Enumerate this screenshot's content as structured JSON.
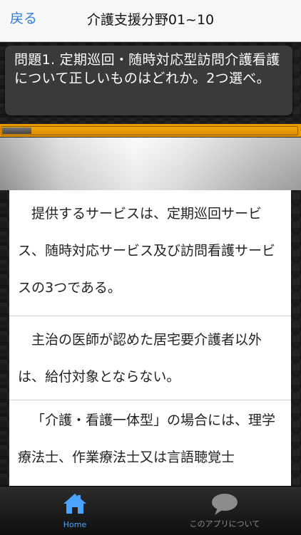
{
  "navbar": {
    "back_label": "戻る",
    "title": "介護支援分野01~10"
  },
  "question": {
    "text": "問題1. 定期巡回・随時対応型訪問介護看護について正しいものはどれか。2つ選べ。"
  },
  "progress": {
    "fraction": 0.1
  },
  "answers": [
    {
      "text": "提供するサービスは、定期巡回サービス、随時対応サービス及び訪問看護サービスの3つである。"
    },
    {
      "text": "主治の医師が認めた居宅要介護者以外は、給付対象とならない。"
    },
    {
      "text": "「介護・看護一体型」の場合には、理学療法士、作業療法士又は言語聴覚士"
    }
  ],
  "tabbar": {
    "home": {
      "label": "Home",
      "icon": "house-icon",
      "color": "#4aa3ff"
    },
    "about": {
      "label": "このアプリについて",
      "icon": "speech-bubble-icon",
      "color": "#8c8c8c"
    }
  },
  "colors": {
    "accent": "#2d7be0",
    "progress_orange": "#e69a00",
    "question_bg": "#3a3a3a"
  }
}
